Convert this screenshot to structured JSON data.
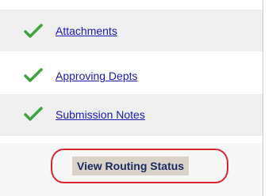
{
  "links": [
    {
      "label": "Attachments",
      "icon": "check-icon"
    },
    {
      "label": "Approving Depts",
      "icon": "check-icon"
    },
    {
      "label": "Submission Notes",
      "icon": "check-icon"
    }
  ],
  "status_button": {
    "label": "View Routing Status"
  },
  "colors": {
    "check": "#3ea33e",
    "link": "#1a1ab2",
    "highlight_ring": "#d9262b",
    "button_bg": "#d8d2c8",
    "button_text": "#1b2b60"
  }
}
